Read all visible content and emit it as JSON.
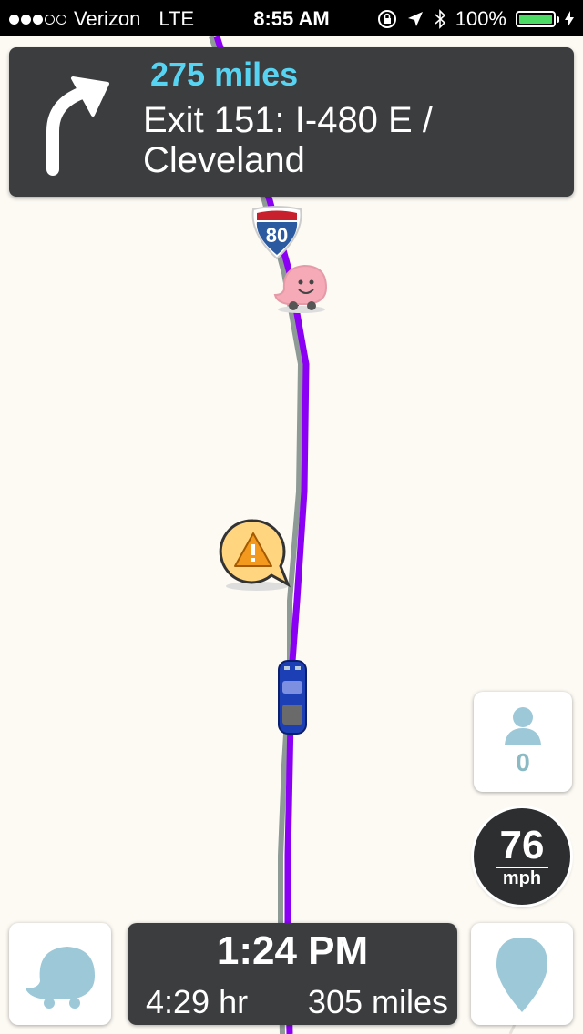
{
  "status_bar": {
    "carrier": "Verizon",
    "network": "LTE",
    "time": "8:55 AM",
    "battery": "100%",
    "signal_bars_on": 3,
    "signal_bars_total": 5
  },
  "navigation": {
    "distance": "275 miles",
    "instruction": "Exit 151: I-480 E / Cleveland",
    "turn_icon": "turn-right-arrow-icon"
  },
  "map": {
    "highway_shield": "80",
    "route_color": "#8b00f4",
    "markers": [
      "waze-user-icon",
      "hazard-warning-icon",
      "car-icon"
    ]
  },
  "riders": {
    "count": "0"
  },
  "speedometer": {
    "speed": "76",
    "unit": "mph"
  },
  "eta": {
    "arrival_time": "1:24 PM",
    "duration": "4:29 hr",
    "remaining_distance": "305 miles"
  },
  "colors": {
    "accent_blue": "#58d4f3",
    "panel_dark": "#3b3d3f",
    "icon_blue": "#9cc8d8"
  }
}
